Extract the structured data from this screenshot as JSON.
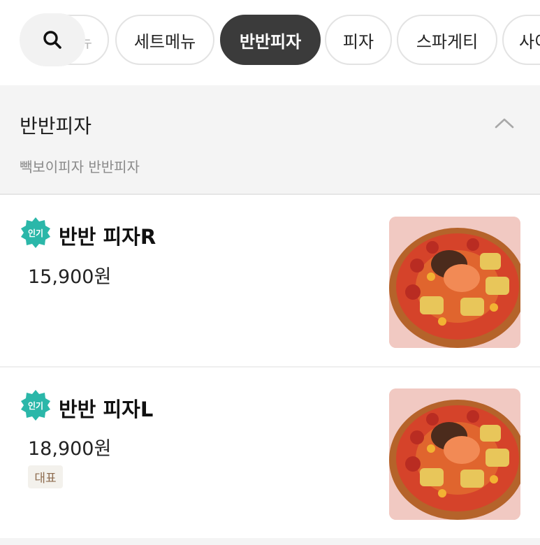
{
  "tabs": {
    "partial_left_label": "뉴",
    "items": [
      {
        "label": "세트메뉴",
        "active": false
      },
      {
        "label": "반반피자",
        "active": true
      },
      {
        "label": "피자",
        "active": false
      },
      {
        "label": "스파게티",
        "active": false
      },
      {
        "label": "사이드",
        "active": false
      }
    ]
  },
  "section": {
    "title": "반반피자",
    "subtitle": "빽보이피자 반반피자"
  },
  "menu_items": [
    {
      "badge": "인기",
      "name": "반반 피자R",
      "price": "15,900원"
    },
    {
      "badge": "인기",
      "name": "반반 피자L",
      "price": "18,900원",
      "tag": "대표"
    }
  ],
  "colors": {
    "active_chip": "#3b3b3b",
    "popular_badge": "#2bb7a9",
    "tag_text": "#8d6b4e"
  },
  "icons": {
    "search": "search-icon",
    "collapse": "chevron-up-icon"
  }
}
